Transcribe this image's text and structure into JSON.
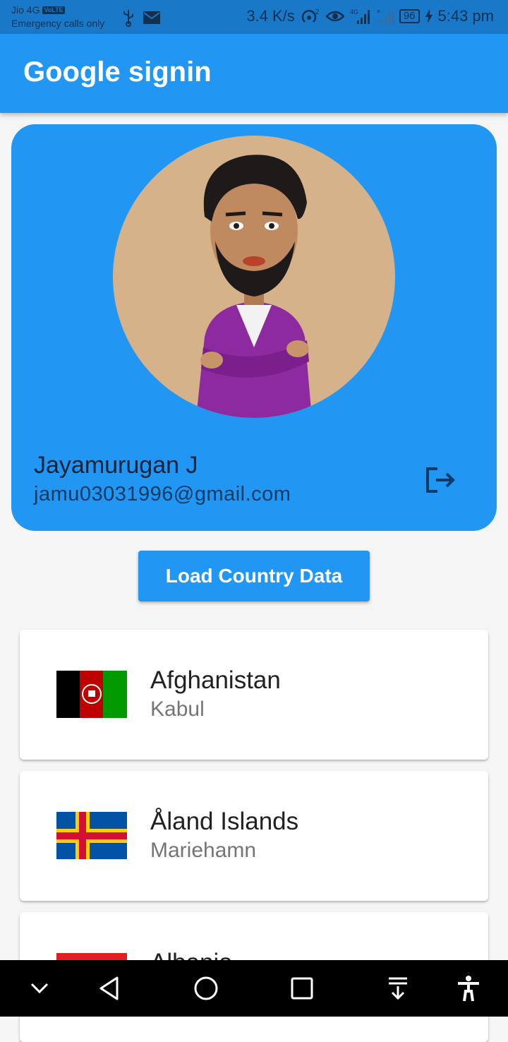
{
  "status_bar": {
    "carrier": "Jio 4G",
    "volte": "VoLTE",
    "emergency": "Emergency calls only",
    "net_speed": "3.4 K/s",
    "battery": "96",
    "time": "5:43 pm",
    "icons": [
      "usb-icon",
      "mail-icon",
      "hotspot-icon",
      "eye-comfort-icon",
      "signal-4g-icon",
      "signal-icon",
      "battery-icon",
      "charging-icon"
    ]
  },
  "app_bar": {
    "title": "Google signin"
  },
  "profile": {
    "name": "Jayamurugan J",
    "email": "jamu03031996@gmail.com",
    "bg_color": "#2196f3",
    "avatar_bg": "#d5b28a",
    "logout_icon": "logout-icon"
  },
  "load_button": {
    "label": "Load Country Data"
  },
  "countries": [
    {
      "name": "Afghanistan",
      "capital": "Kabul",
      "flag": "afghanistan-flag-icon"
    },
    {
      "name": "Åland Islands",
      "capital": "Mariehamn",
      "flag": "aland-flag-icon"
    },
    {
      "name": "Albania",
      "capital": "",
      "flag": "albania-flag-icon"
    }
  ],
  "nav_bar": {
    "icons": [
      "hide-nav-icon",
      "back-icon",
      "home-icon",
      "recents-icon",
      "notifications-pulldown-icon",
      "accessibility-icon"
    ]
  }
}
